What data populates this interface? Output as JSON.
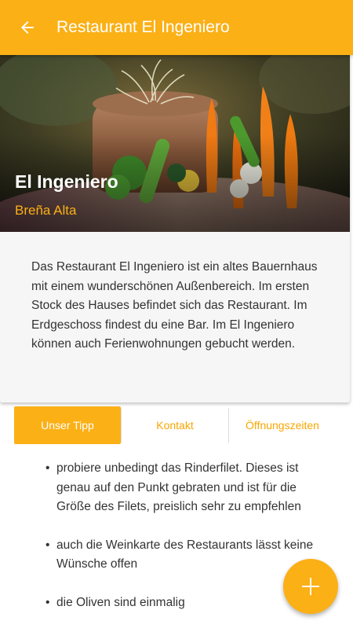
{
  "appbar": {
    "title": "Restaurant El Ingeniero",
    "back_icon": "arrow-left-icon"
  },
  "hero": {
    "title": "El Ingeniero",
    "subtitle": "Breña Alta"
  },
  "description": "Das Restaurant El Ingeniero ist ein altes Bauernhaus mit einem wunderschönen Außenbereich. Im ersten Stock des Hauses befindet sich das Restaurant. Im Erdgeschoss findest du eine Bar. Im El Ingeniero können auch Ferienwohnungen gebucht werden.",
  "tabs": [
    {
      "label": "Unser Tipp",
      "active": true
    },
    {
      "label": "Kontakt",
      "active": false
    },
    {
      "label": "Öffnungszeiten",
      "active": false
    }
  ],
  "tips": [
    "probiere unbedingt das Rinderfilet. Dieses ist genau auf den Punkt gebraten und ist für die Größe des Filets, preislich sehr zu empfehlen",
    "auch die Weinkarte des Restaurants lässt keine Wünsche offen",
    "die Oliven sind einmalig"
  ],
  "fab": {
    "icon": "plus-icon"
  },
  "colors": {
    "accent": "#fbb016",
    "text": "#333333",
    "card_bg": "#f6f6f6"
  }
}
